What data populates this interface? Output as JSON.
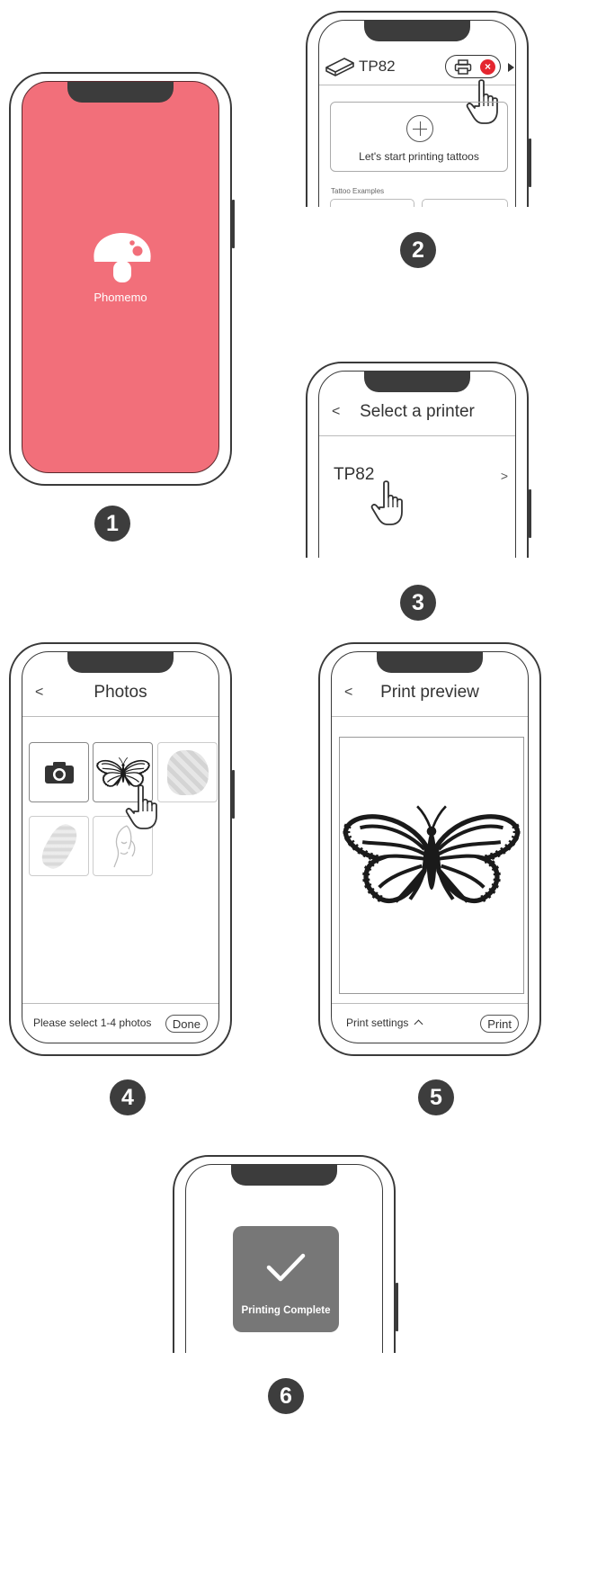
{
  "colors": {
    "splash_bg": "#f26f7a",
    "dark": "#3d3d3d",
    "complete_bg": "#777777"
  },
  "steps": [
    "1",
    "2",
    "3",
    "4",
    "5",
    "6"
  ],
  "screen1": {
    "brand": "Phomemo",
    "logo_icon": "mushroom-logo-icon"
  },
  "screen2": {
    "printer_name": "TP82",
    "start_label": "Let's start printing tattoos",
    "examples_label": "Tattoo Examples",
    "icons": [
      "printer-box-icon",
      "printer-icon",
      "disconnect-icon",
      "play-arrow-icon",
      "plus-icon",
      "hand-pointer-icon"
    ]
  },
  "screen3": {
    "title": "Select a printer",
    "back": "<",
    "printer_item": "TP82",
    "chevron": ">"
  },
  "screen4": {
    "title": "Photos",
    "back": "<",
    "hint": "Please select 1-4 photos",
    "done": "Done",
    "icons": [
      "camera-icon",
      "butterfly-icon",
      "hand-pointer-icon"
    ]
  },
  "screen5": {
    "title": "Print preview",
    "back": "<",
    "settings": "Print settings",
    "print": "Print",
    "icons": [
      "butterfly-icon",
      "chevron-up-icon"
    ]
  },
  "screen6": {
    "message": "Printing Complete",
    "icons": [
      "checkmark-icon"
    ]
  }
}
